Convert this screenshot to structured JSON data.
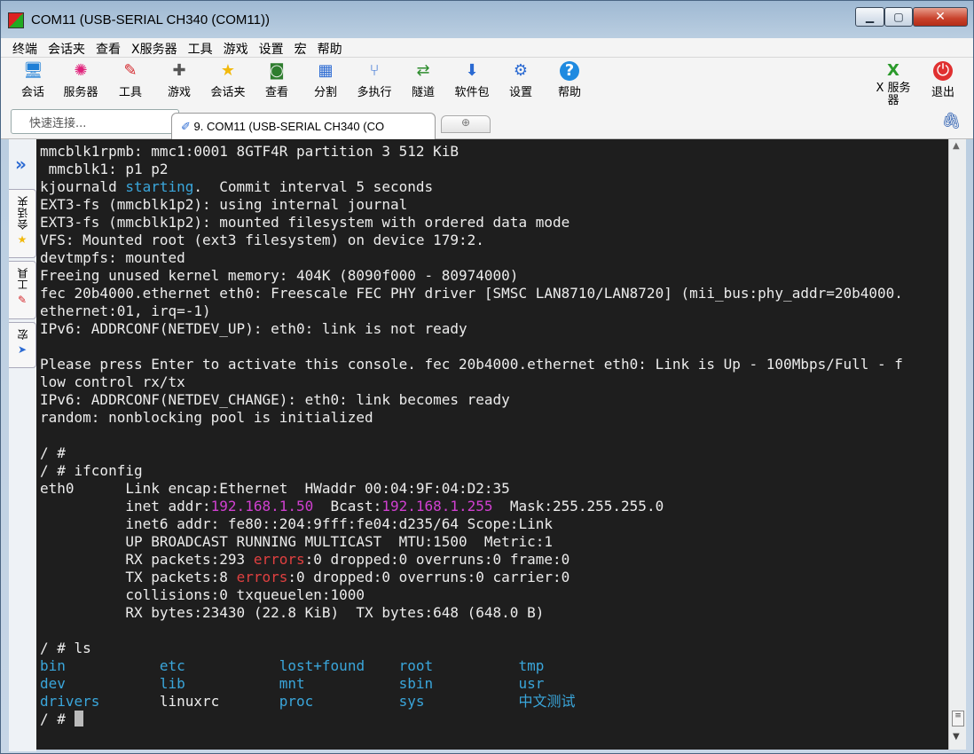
{
  "window": {
    "title": "COM11  (USB-SERIAL CH340 (COM11))",
    "btn_min": "▁",
    "btn_max": "▢",
    "btn_close": "✕"
  },
  "menu": [
    "终端",
    "会话夹",
    "查看",
    "X服务器",
    "工具",
    "游戏",
    "设置",
    "宏",
    "帮助"
  ],
  "toolbar": {
    "items": [
      {
        "label": "会话",
        "icon": "session-icon"
      },
      {
        "label": "服务器",
        "icon": "servers-icon"
      },
      {
        "label": "工具",
        "icon": "tools-icon"
      },
      {
        "label": "游戏",
        "icon": "games-icon"
      },
      {
        "label": "会话夹",
        "icon": "star-icon"
      },
      {
        "label": "查看",
        "icon": "view-icon"
      },
      {
        "label": "分割",
        "icon": "split-icon"
      },
      {
        "label": "多执行",
        "icon": "multiexec-icon"
      },
      {
        "label": "隧道",
        "icon": "tunneling-icon"
      },
      {
        "label": "软件包",
        "icon": "packages-icon"
      },
      {
        "label": "设置",
        "icon": "settings-icon"
      },
      {
        "label": "帮助",
        "icon": "help-icon"
      }
    ],
    "xserver_label": "X 服务器",
    "exit_label": "退出"
  },
  "address": {
    "quick_connect_placeholder": "快速连接...",
    "active_tab": "9. COM11  (USB-SERIAL CH340 (CO"
  },
  "sidebar": {
    "tabs": [
      "会话夹",
      "工具",
      "宏"
    ]
  },
  "colors": {
    "terminal_bg": "#1e1e1e",
    "terminal_fg": "#ececec",
    "highlight_cyan": "#3aa6db",
    "highlight_magenta": "#d040d0",
    "highlight_red": "#e04040"
  },
  "terminal": {
    "lines": [
      [
        {
          "t": "mmcblk1rpmb: mmc1:0001 8GTF4R partition 3 512 KiB"
        }
      ],
      [
        {
          "t": " mmcblk1: p1 p2"
        }
      ],
      [
        {
          "t": "kjournald "
        },
        {
          "t": "starting",
          "c": "cyan"
        },
        {
          "t": ".  Commit interval 5 seconds"
        }
      ],
      [
        {
          "t": "EXT3-fs (mmcblk1p2): using internal journal"
        }
      ],
      [
        {
          "t": "EXT3-fs (mmcblk1p2): mounted filesystem with ordered data mode"
        }
      ],
      [
        {
          "t": "VFS: Mounted root (ext3 filesystem) on device 179:2."
        }
      ],
      [
        {
          "t": "devtmpfs: mounted"
        }
      ],
      [
        {
          "t": "Freeing unused kernel memory: 404K (8090f000 - 80974000)"
        }
      ],
      [
        {
          "t": "fec 20b4000.ethernet eth0: Freescale FEC PHY driver [SMSC LAN8710/LAN8720] (mii_bus:phy_addr=20b4000."
        }
      ],
      [
        {
          "t": "ethernet:01, irq=-1)"
        }
      ],
      [
        {
          "t": "IPv6: ADDRCONF(NETDEV_UP): eth0: link is not ready"
        }
      ],
      [
        {
          "t": ""
        }
      ],
      [
        {
          "t": "Please press Enter to activate this console. fec 20b4000.ethernet eth0: Link is Up - 100Mbps/Full - f"
        }
      ],
      [
        {
          "t": "low control rx/tx"
        }
      ],
      [
        {
          "t": "IPv6: ADDRCONF(NETDEV_CHANGE): eth0: link becomes ready"
        }
      ],
      [
        {
          "t": "random: nonblocking pool is initialized"
        }
      ],
      [
        {
          "t": ""
        }
      ],
      [
        {
          "t": "/ #"
        }
      ],
      [
        {
          "t": "/ # ifconfig"
        }
      ],
      [
        {
          "t": "eth0      Link encap:Ethernet  HWaddr 00:04:9F:04:D2:35"
        }
      ],
      [
        {
          "t": "          inet addr:"
        },
        {
          "t": "192.168.1.50",
          "c": "mag"
        },
        {
          "t": "  Bcast:"
        },
        {
          "t": "192.168.1.255",
          "c": "mag"
        },
        {
          "t": "  Mask:255.255.255.0"
        }
      ],
      [
        {
          "t": "          inet6 addr: fe80::204:9fff:fe04:d235/64 Scope:Link"
        }
      ],
      [
        {
          "t": "          UP BROADCAST RUNNING MULTICAST  MTU:1500  Metric:1"
        }
      ],
      [
        {
          "t": "          RX packets:293 "
        },
        {
          "t": "errors",
          "c": "red"
        },
        {
          "t": ":0 dropped:0 overruns:0 frame:0"
        }
      ],
      [
        {
          "t": "          TX packets:8 "
        },
        {
          "t": "errors",
          "c": "red"
        },
        {
          "t": ":0 dropped:0 overruns:0 carrier:0"
        }
      ],
      [
        {
          "t": "          collisions:0 txqueuelen:1000"
        }
      ],
      [
        {
          "t": "          RX bytes:23430 (22.8 KiB)  TX bytes:648 (648.0 B)"
        }
      ],
      [
        {
          "t": ""
        }
      ],
      [
        {
          "t": "/ # ls"
        }
      ],
      [
        {
          "t": "bin",
          "c": "cyan"
        },
        {
          "t": "           "
        },
        {
          "t": "etc",
          "c": "cyan"
        },
        {
          "t": "           "
        },
        {
          "t": "lost+found",
          "c": "cyan"
        },
        {
          "t": "    "
        },
        {
          "t": "root",
          "c": "cyan"
        },
        {
          "t": "          "
        },
        {
          "t": "tmp",
          "c": "cyan"
        }
      ],
      [
        {
          "t": "dev",
          "c": "cyan"
        },
        {
          "t": "           "
        },
        {
          "t": "lib",
          "c": "cyan"
        },
        {
          "t": "           "
        },
        {
          "t": "mnt",
          "c": "cyan"
        },
        {
          "t": "           "
        },
        {
          "t": "sbin",
          "c": "cyan"
        },
        {
          "t": "          "
        },
        {
          "t": "usr",
          "c": "cyan"
        }
      ],
      [
        {
          "t": "drivers",
          "c": "cyan"
        },
        {
          "t": "       "
        },
        {
          "t": "linuxrc"
        },
        {
          "t": "       "
        },
        {
          "t": "proc",
          "c": "cyan"
        },
        {
          "t": "          "
        },
        {
          "t": "sys",
          "c": "cyan"
        },
        {
          "t": "           "
        },
        {
          "t": "中文测试",
          "c": "cyan"
        }
      ],
      [
        {
          "t": "/ # "
        }
      ]
    ]
  }
}
